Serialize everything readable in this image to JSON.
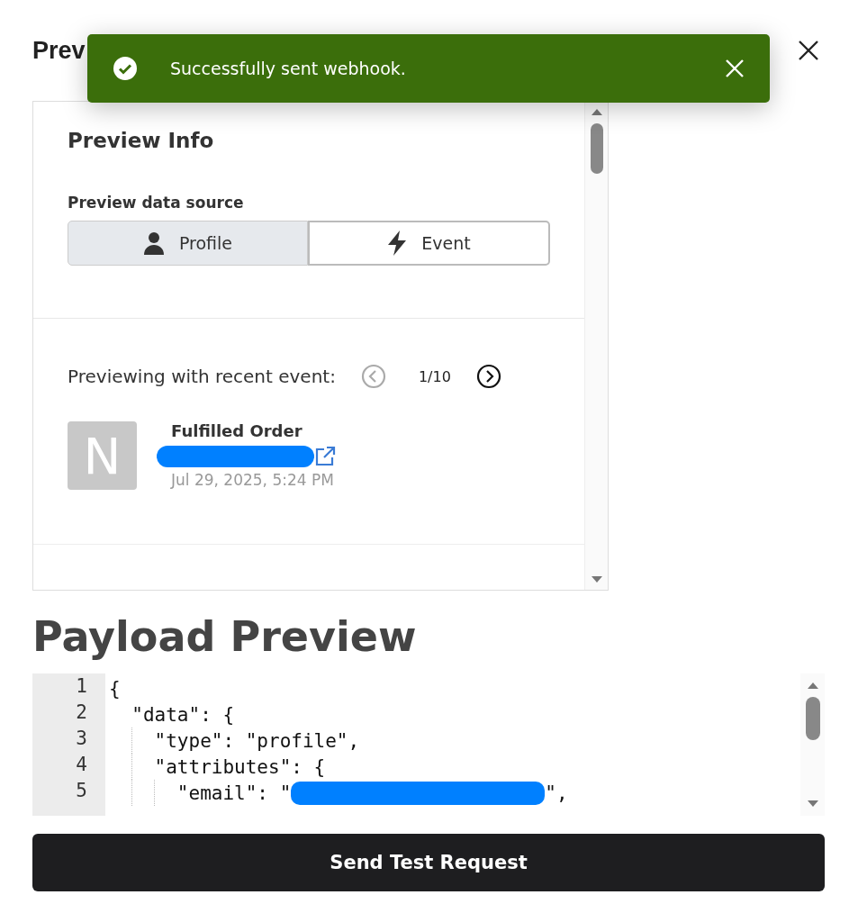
{
  "dialog": {
    "title": "Prev"
  },
  "toast": {
    "message": "Successfully sent webhook."
  },
  "preview_info": {
    "title": "Preview Info",
    "source_label": "Preview data source",
    "sources": [
      {
        "label": "Profile",
        "kind": "person",
        "selected": true
      },
      {
        "label": "Event",
        "kind": "bolt",
        "selected": false
      }
    ],
    "recent_label": "Previewing with recent event:",
    "pager": {
      "count": "1/10",
      "prev_disabled": true,
      "next_disabled": false
    },
    "event": {
      "avatar": "N",
      "name": "Fulfilled Order",
      "time": "Jul 29, 2025, 5:24 PM"
    }
  },
  "payload": {
    "title": "Payload Preview",
    "lines": [
      {
        "number": "1",
        "text": "{",
        "redacted": false
      },
      {
        "number": "2",
        "text": "  \"data\": {",
        "redacted": false
      },
      {
        "number": "3",
        "text": "    \"type\": \"profile\",",
        "redacted": false
      },
      {
        "number": "4",
        "text": "    \"attributes\": {",
        "redacted": false
      },
      {
        "number": "5",
        "text": "      \"email\": \"",
        "after": "\",",
        "redacted": true
      }
    ]
  },
  "send_button": "Send Test Request"
}
